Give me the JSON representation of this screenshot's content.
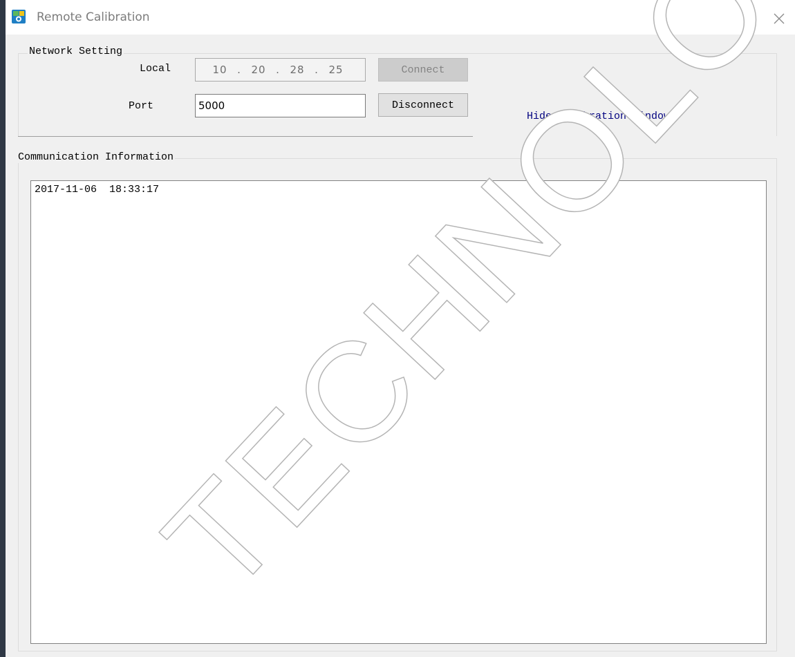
{
  "window": {
    "title": "Remote Calibration",
    "close_glyph": "✕"
  },
  "network": {
    "group_label": "Network Setting",
    "local_label": "Local",
    "ip_segments": [
      "10",
      "20",
      "28",
      "25"
    ],
    "ip_separator": ".",
    "port_label": "Port",
    "port_value": "5000",
    "connect_label": "Connect",
    "disconnect_label": "Disconnect",
    "hide_window_label": "Hide calibration window"
  },
  "communication": {
    "group_label": "Communication Information",
    "log_text": "2017-11-06  18:33:17"
  },
  "watermark": {
    "text": "TECHNOLOGY"
  },
  "icons": {
    "app": "calibration-app-icon",
    "close": "close-icon"
  },
  "colors": {
    "link": "#00007f",
    "disabled_button": "#cccccc",
    "window_bg": "#f0f0f0"
  }
}
